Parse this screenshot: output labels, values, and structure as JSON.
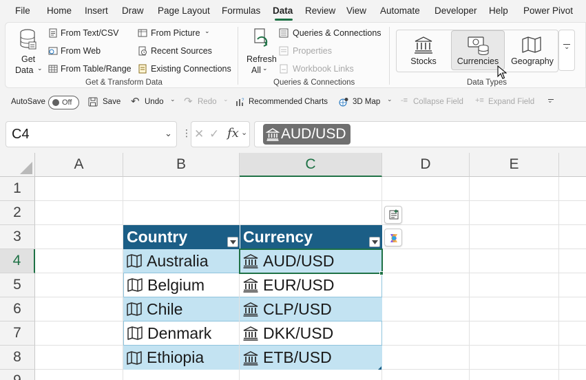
{
  "menu": {
    "tabs": [
      "File",
      "Home",
      "Insert",
      "Draw",
      "Page Layout",
      "Formulas",
      "Data",
      "Review",
      "View",
      "Automate",
      "Developer",
      "Help",
      "Power Pivot"
    ],
    "active": "Data"
  },
  "ribbon": {
    "get_data": {
      "line1": "Get",
      "line2": "Data"
    },
    "from_text_csv": "From Text/CSV",
    "from_web": "From Web",
    "from_table_range": "From Table/Range",
    "from_picture": "From Picture",
    "recent_sources": "Recent Sources",
    "existing_connections": "Existing Connections",
    "get_transform_label": "Get & Transform Data",
    "refresh": {
      "line1": "Refresh",
      "line2": "All"
    },
    "queries_connections": "Queries & Connections",
    "properties": "Properties",
    "workbook_links": "Workbook Links",
    "queries_label": "Queries & Connections",
    "stocks": "Stocks",
    "currencies": "Currencies",
    "geography": "Geography",
    "data_types_label": "Data Types"
  },
  "qat": {
    "autosave": "AutoSave",
    "autosave_state": "Off",
    "save": "Save",
    "undo": "Undo",
    "redo": "Redo",
    "recommended_charts": "Recommended Charts",
    "map_3d": "3D Map",
    "collapse_field": "Collapse Field",
    "expand_field": "Expand Field"
  },
  "formula_bar": {
    "name_box": "C4",
    "formula_value": "AUD/USD"
  },
  "grid": {
    "columns": [
      "A",
      "B",
      "C",
      "D",
      "E"
    ],
    "rows": [
      "1",
      "2",
      "3",
      "4",
      "5",
      "6",
      "7",
      "8",
      "9"
    ],
    "table": {
      "headers": [
        "Country",
        "Currency"
      ],
      "rows": [
        {
          "country": "Australia",
          "currency": "AUD/USD"
        },
        {
          "country": "Belgium",
          "currency": "EUR/USD"
        },
        {
          "country": "Chile",
          "currency": "CLP/USD"
        },
        {
          "country": "Denmark",
          "currency": "DKK/USD"
        },
        {
          "country": "Ethiopia",
          "currency": "ETB/USD"
        }
      ]
    }
  },
  "colors": {
    "accent": "#1e7145",
    "table_header": "#1b5e86",
    "table_band": "#c3e3f2"
  }
}
